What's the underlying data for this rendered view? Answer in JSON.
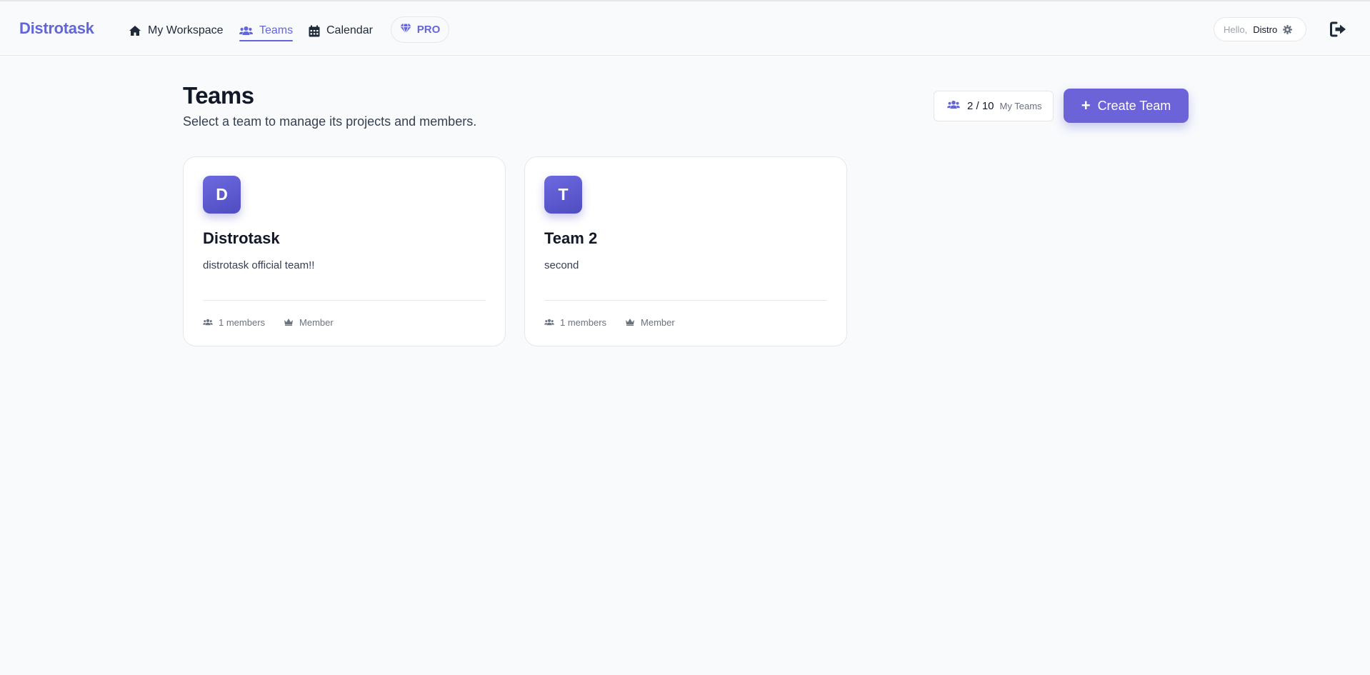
{
  "app": {
    "brand": "Distrotask"
  },
  "nav": {
    "items": [
      {
        "label": "My Workspace",
        "icon": "home-icon",
        "active": false
      },
      {
        "label": "Teams",
        "icon": "users-icon",
        "active": true
      },
      {
        "label": "Calendar",
        "icon": "calendar-icon",
        "active": false
      }
    ],
    "pro_label": "PRO",
    "pro_icon": "gem-icon"
  },
  "user": {
    "greeting": "Hello,",
    "name": "Distro",
    "settings_icon": "gear-icon",
    "logout_icon": "logout-icon"
  },
  "page": {
    "title": "Teams",
    "subtitle": "Select a team to manage its projects and members."
  },
  "team_count": {
    "value": "2 / 10",
    "label": "My Teams",
    "icon": "users-icon"
  },
  "create_button": {
    "label": "Create Team",
    "icon": "plus-icon"
  },
  "teams": [
    {
      "initial": "D",
      "name": "Distrotask",
      "description": "distrotask official team!!",
      "members": "1 members",
      "role": "Member"
    },
    {
      "initial": "T",
      "name": "Team 2",
      "description": "second",
      "members": "1 members",
      "role": "Member"
    }
  ],
  "colors": {
    "accent": "#6366d9",
    "button": "#6c63d9",
    "background": "#f8fafc"
  }
}
